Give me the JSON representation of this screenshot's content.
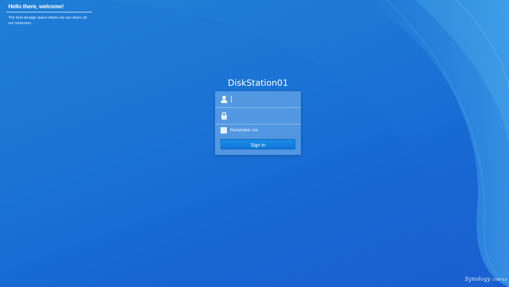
{
  "welcome": {
    "title": "Hello there, welcome!",
    "subtitle": "The best storage space where we can share all our memories"
  },
  "login": {
    "server_name": "DiskStation01",
    "username_value": "",
    "password_value": "",
    "user_icon": "user-icon",
    "password_icon": "lock-icon",
    "remember_label": "Remember me",
    "remember_checked": false,
    "signin_label": "Sign in"
  },
  "brand": {
    "logo": "Synology",
    "product": "DSM 6.0"
  },
  "colors": {
    "background": "#1b73d4",
    "button": "#1482e0",
    "panel": "#7fb8ee"
  }
}
